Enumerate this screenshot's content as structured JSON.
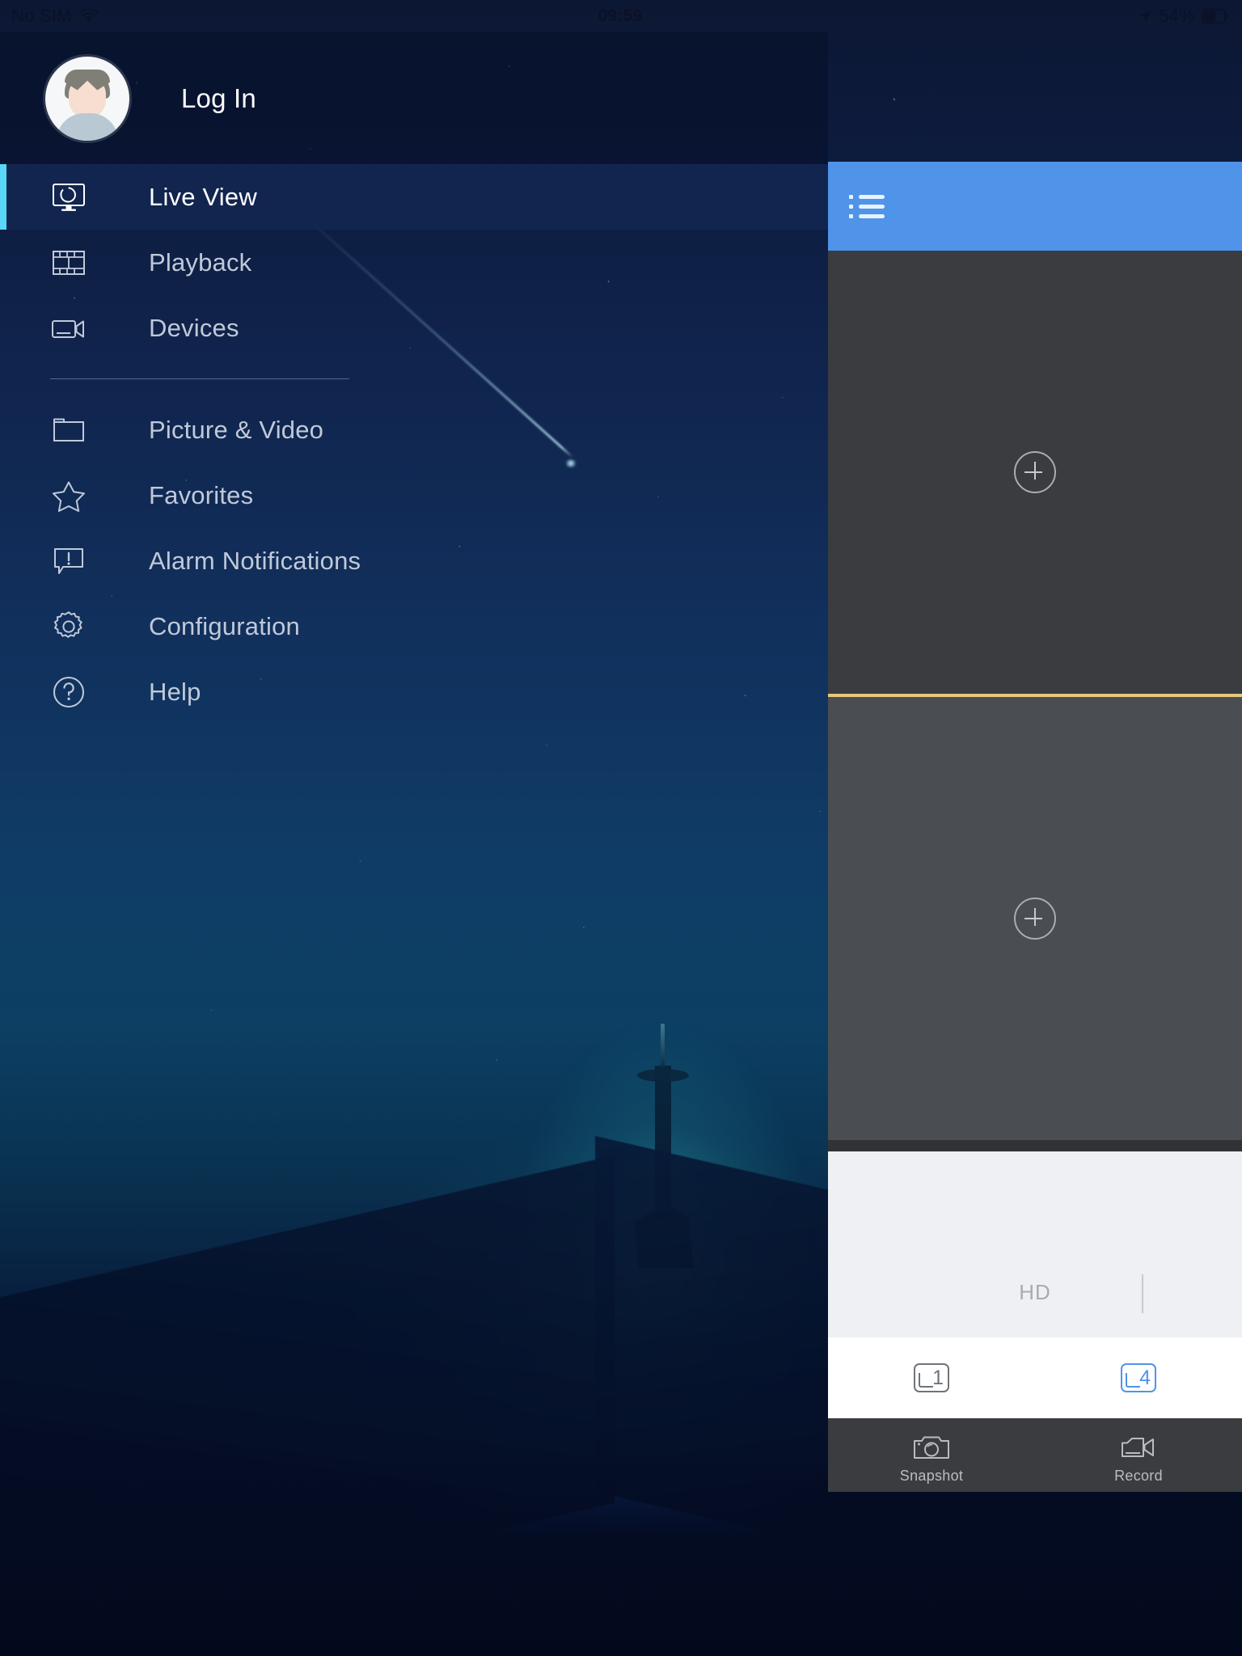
{
  "status_bar": {
    "carrier": "No SIM",
    "wifi_icon": "wifi-icon",
    "time": "09:59",
    "location_icon": "location-arrow-icon",
    "battery_percent": "54%",
    "battery_icon": "battery-icon"
  },
  "sidebar": {
    "profile": {
      "avatar_icon": "user-avatar-icon",
      "label": "Log In"
    },
    "items": [
      {
        "label": "Live View",
        "icon": "monitor-icon",
        "active": true
      },
      {
        "label": "Playback",
        "icon": "film-strip-icon",
        "active": false
      },
      {
        "label": "Devices",
        "icon": "video-camera-icon",
        "active": false
      },
      {
        "label": "Picture & Video",
        "icon": "folder-icon",
        "active": false
      },
      {
        "label": "Favorites",
        "icon": "star-icon",
        "active": false
      },
      {
        "label": "Alarm Notifications",
        "icon": "alert-bubble-icon",
        "active": false
      },
      {
        "label": "Configuration",
        "icon": "gear-icon",
        "active": false
      },
      {
        "label": "Help",
        "icon": "question-circle-icon",
        "active": false
      }
    ]
  },
  "live_view": {
    "header": {
      "menu_icon": "list-menu-icon"
    },
    "windows": [
      {
        "add_icon": "plus-circle-icon",
        "state": "empty",
        "selected": false
      },
      {
        "add_icon": "plus-circle-icon",
        "state": "empty",
        "selected": true
      }
    ],
    "stream_quality": {
      "label": "HD"
    },
    "layout_buttons": [
      {
        "label": "1",
        "selected": false
      },
      {
        "label": "4",
        "selected": true
      }
    ],
    "toolbar": [
      {
        "label": "Snapshot",
        "icon": "camera-icon"
      },
      {
        "label": "Record",
        "icon": "video-record-icon"
      }
    ]
  },
  "colors": {
    "accent_cyan": "#5ad7f7",
    "header_blue": "#4f94e8",
    "selected_window_border": "#e6c97a",
    "sidebar_active_bg": "#132752",
    "panel_dark": "#3a3c40",
    "panel_light": "#4a4d52"
  }
}
